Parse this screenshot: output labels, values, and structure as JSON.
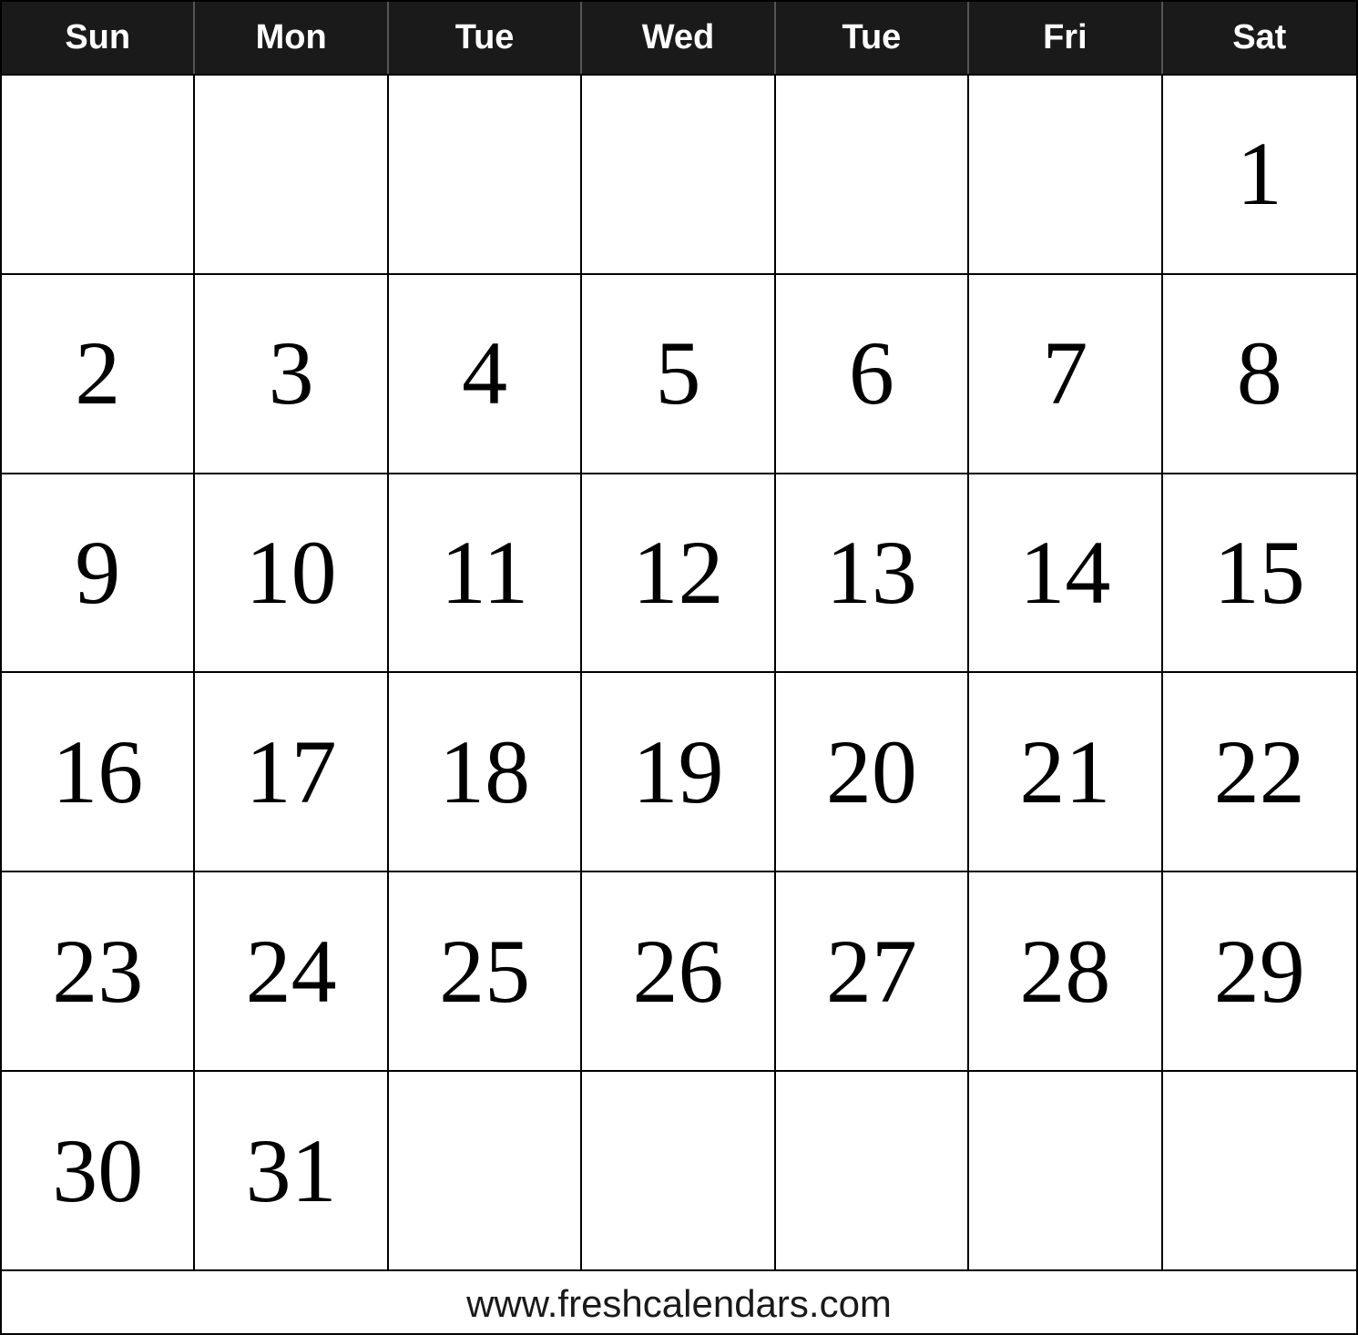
{
  "calendar": {
    "header": {
      "days": [
        "Sun",
        "Mon",
        "Tue",
        "Wed",
        "Tue",
        "Fri",
        "Sat"
      ]
    },
    "rows": [
      [
        null,
        null,
        null,
        null,
        null,
        null,
        1
      ],
      [
        2,
        3,
        4,
        5,
        6,
        7,
        8
      ],
      [
        9,
        10,
        11,
        12,
        13,
        14,
        15
      ],
      [
        16,
        17,
        18,
        19,
        20,
        21,
        22
      ],
      [
        23,
        24,
        25,
        26,
        27,
        28,
        29
      ],
      [
        30,
        31,
        null,
        null,
        null,
        null,
        null
      ]
    ],
    "footer": "www.freshcalendars.com"
  }
}
